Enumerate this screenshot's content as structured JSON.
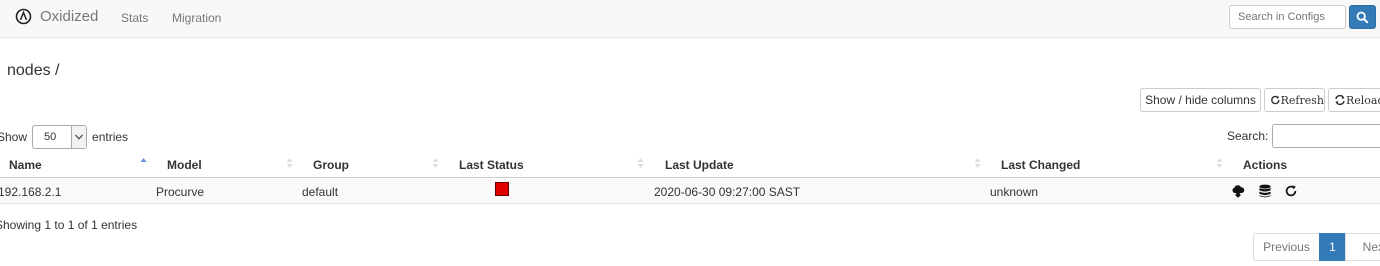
{
  "nav": {
    "brand": "Oxidized",
    "links": [
      "Stats",
      "Migration"
    ],
    "search_placeholder": "Search in Configs"
  },
  "page": {
    "title": "nodes /"
  },
  "toolbar": {
    "show_hide": "Show / hide columns",
    "refresh": "Refresh",
    "reload": "Reload"
  },
  "table_controls": {
    "show_prefix": "Show",
    "page_length": "50",
    "entries_suffix": "entries",
    "search_label": "Search:"
  },
  "table": {
    "columns": [
      "Name",
      "Model",
      "Group",
      "Last Status",
      "Last Update",
      "Last Changed",
      "Actions"
    ],
    "rows": [
      {
        "name": "192.168.2.1",
        "model": "Procurve",
        "group": "default",
        "last_status": "failed",
        "last_update": "2020-06-30 09:27:00 SAST",
        "last_changed": "unknown"
      }
    ]
  },
  "info": "Showing 1 to 1 of 1 entries",
  "pagination": {
    "previous": "Previous",
    "current": "1",
    "next": "Next"
  },
  "colors": {
    "primary": "#337ab7",
    "status_failed": "#e00000",
    "navbar_bg": "#f8f8f8"
  },
  "icons": {
    "brand": "power-circle-icon",
    "search": "search-icon",
    "refresh": "refresh-icon",
    "reload": "reload-icon",
    "actions": [
      "cloud-download-icon",
      "database-icon",
      "refresh-icon"
    ]
  }
}
